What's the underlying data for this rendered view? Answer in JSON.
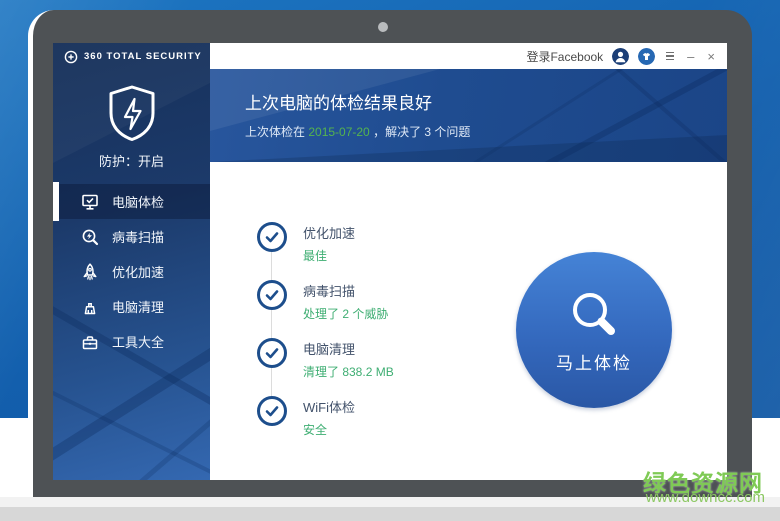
{
  "window": {
    "logo_text": "360 TOTAL SECURITY",
    "titlebar": {
      "login_label": "登录Facebook",
      "minimize_glyph": "–",
      "close_glyph": "×"
    },
    "sidebar": {
      "protection_label": "防护：开启",
      "items": [
        {
          "label": "电脑体检",
          "icon": "monitor-check-icon",
          "active": true
        },
        {
          "label": "病毒扫描",
          "icon": "virus-scan-icon",
          "active": false
        },
        {
          "label": "优化加速",
          "icon": "rocket-icon",
          "active": false
        },
        {
          "label": "电脑清理",
          "icon": "broom-icon",
          "active": false
        },
        {
          "label": "工具大全",
          "icon": "toolbox-icon",
          "active": false
        }
      ]
    },
    "header": {
      "title": "上次电脑的体检结果良好",
      "subtitle_prefix": "上次体检在 ",
      "subtitle_date": "2015-07-20",
      "subtitle_suffix": " ，解决了 3 个问题"
    },
    "checklist": [
      {
        "label": "优化加速",
        "status": "最佳"
      },
      {
        "label": "病毒扫描",
        "status": "处理了 2 个威胁"
      },
      {
        "label": "电脑清理",
        "status": "清理了 838.2 MB"
      },
      {
        "label": "WiFi体检",
        "status": "安全"
      }
    ],
    "check_button_label": "马上体检"
  },
  "watermark": {
    "site_name": "绿色资源网",
    "site_url": "www.downcc.com"
  },
  "colors": {
    "backdrop_blue": "#135fad",
    "bezel_gray": "#4e5255",
    "sidebar_navy": "#1c3a6a",
    "header_blue": "#1f4c90",
    "accent_green_date": "#55b44e",
    "accent_green_status": "#3fae73",
    "check_circle_blue": "#1d4e8c",
    "button_blue": "#3469be",
    "watermark_green": "#7fca55"
  }
}
